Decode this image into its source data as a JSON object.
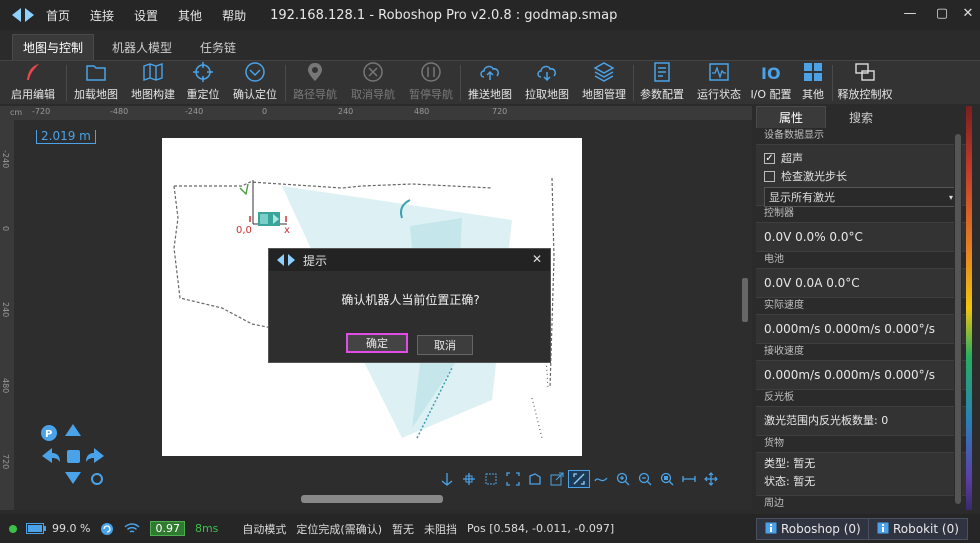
{
  "titlebar": {
    "menu": [
      "首页",
      "连接",
      "设置",
      "其他",
      "帮助"
    ],
    "title": "192.168.128.1 - Roboshop Pro v2.0.8 : godmap.smap",
    "controls": [
      "—",
      "▢",
      "✕"
    ]
  },
  "tabs": [
    {
      "label": "地图与控制",
      "active": true
    },
    {
      "label": "机器人模型",
      "active": false
    },
    {
      "label": "任务链",
      "active": false
    }
  ],
  "toolbar": [
    {
      "label": "启用编辑",
      "icon": "feather-icon",
      "disabled": false
    },
    {
      "label": "加载地图",
      "icon": "folder-icon",
      "disabled": false
    },
    {
      "label": "地图构建",
      "icon": "map-icon",
      "disabled": false
    },
    {
      "label": "重定位",
      "icon": "crosshair-icon",
      "disabled": false
    },
    {
      "label": "确认定位",
      "icon": "check-circle-icon",
      "disabled": false
    },
    {
      "label": "路径导航",
      "icon": "pin-icon",
      "disabled": true
    },
    {
      "label": "取消导航",
      "icon": "cancel-icon",
      "disabled": true
    },
    {
      "label": "暂停导航",
      "icon": "pause-icon",
      "disabled": true
    },
    {
      "label": "推送地图",
      "icon": "cloud-upload-icon",
      "disabled": false
    },
    {
      "label": "拉取地图",
      "icon": "cloud-download-icon",
      "disabled": false
    },
    {
      "label": "地图管理",
      "icon": "layers-icon",
      "disabled": false
    },
    {
      "label": "参数配置",
      "icon": "settings-doc-icon",
      "disabled": false
    },
    {
      "label": "运行状态",
      "icon": "waveform-icon",
      "disabled": false
    },
    {
      "label": "I/O 配置",
      "icon": "io-icon",
      "disabled": false
    },
    {
      "label": "其他",
      "icon": "grid-icon",
      "disabled": false
    },
    {
      "label": "释放控制权",
      "icon": "release-control-icon",
      "disabled": false
    }
  ],
  "map": {
    "scale": "2.019 m",
    "ruler_unit": "cm",
    "ruler_top": [
      "-720",
      "-480",
      "-240",
      "0",
      "240",
      "480",
      "720"
    ],
    "ruler_left": [
      "-240",
      "0",
      "240",
      "480",
      "720"
    ],
    "origin_label": "0,0",
    "x_label": "x"
  },
  "dialog": {
    "title": "提示",
    "message": "确认机器人当前位置正确?",
    "ok": "确定",
    "cancel": "取消",
    "close": "✕"
  },
  "panel": {
    "tabs": [
      "属性",
      "搜索"
    ],
    "display_title": "设备数据显示",
    "checkbox_ultrasonic": "超声",
    "checkbox_laser_step": "检查激光步长",
    "laser_select": "显示所有激光",
    "controller_title": "控制器",
    "controller_value": "0.0V   0.0%   0.0°C",
    "battery_title": "电池",
    "battery_value": "0.0V   0.0A   0.0°C",
    "actual_speed_title": "实际速度",
    "actual_speed_value": "0.000m/s  0.000m/s  0.000°/s",
    "received_speed_title": "接收速度",
    "received_speed_value": "0.000m/s  0.000m/s  0.000°/s",
    "reflector_title": "反光板",
    "reflector_value": "激光范围内反光板数量:  0",
    "goods_title": "货物",
    "goods_type": "类型:  暂无",
    "goods_status": "状态:  暂无",
    "more_title": "周边"
  },
  "status": {
    "battery": "99.0 %",
    "confidence": "0.97",
    "latency": "8ms",
    "mode": "自动模式",
    "localization": "定位完成(需确认)",
    "none": "暂无",
    "block": "未阻挡",
    "pos": "Pos [0.584, -0.011, -0.097]",
    "roboshop_chip": "Roboshop (0)",
    "robokit_chip": "Robokit (0)"
  }
}
